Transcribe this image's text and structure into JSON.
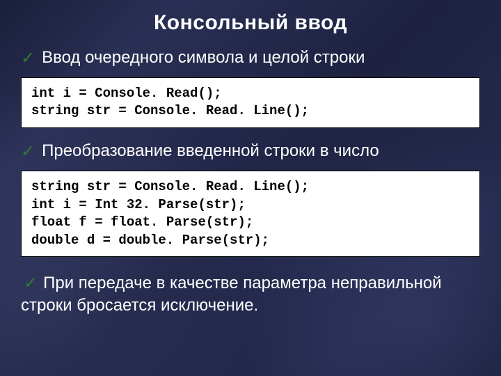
{
  "title": "Консольный ввод",
  "bullets": {
    "b1": "Ввод очередного символа и целой строки",
    "b2": "Преобразование введенной строки в число",
    "b3": "При передаче в качестве параметра неправильной строки бросается исключение."
  },
  "code1": "int i = Console. Read();\nstring str = Console. Read. Line();",
  "code2": "string str = Console. Read. Line();\nint i = Int 32. Parse(str);\nfloat f = float. Parse(str);\ndouble d = double. Parse(str);"
}
